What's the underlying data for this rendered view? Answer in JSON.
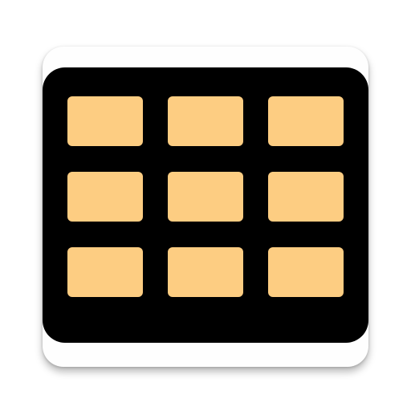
{
  "icon": {
    "name": "grid-app-icon",
    "colors": {
      "background": "#ffffff",
      "tile": "#fefefe",
      "panel": "#000000",
      "cell": "#fdcd82"
    },
    "grid": {
      "rows": 3,
      "cols": 3
    }
  }
}
